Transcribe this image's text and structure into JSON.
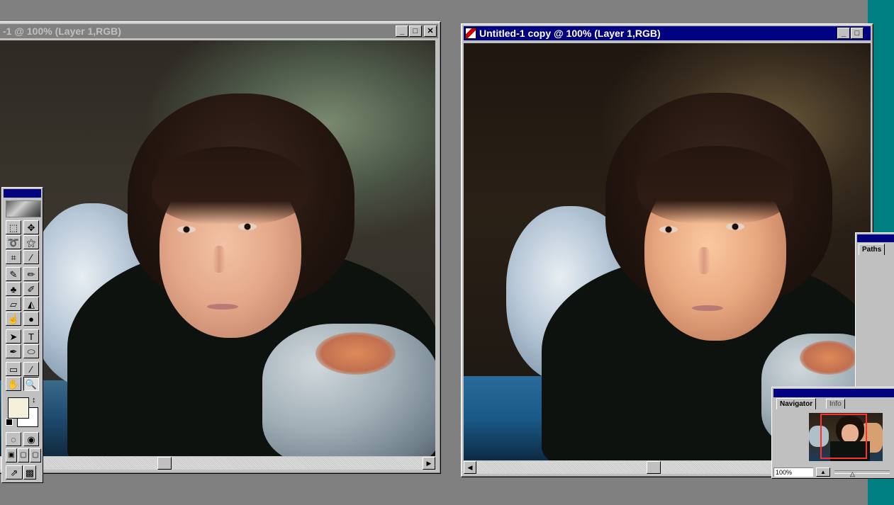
{
  "windows": {
    "original": {
      "title": "-1 @ 100% (Layer 1,RGB)"
    },
    "copy": {
      "title": "Untitled-1 copy @ 100% (Layer 1,RGB)"
    }
  },
  "titlebar_buttons": {
    "minimize": "_",
    "maximize": "□",
    "close": "✕"
  },
  "toolbox": {
    "tools": [
      {
        "name": "marquee-tool-icon",
        "glyph": "⬚"
      },
      {
        "name": "move-tool-icon",
        "glyph": "✥"
      },
      {
        "name": "lasso-tool-icon",
        "glyph": "➰"
      },
      {
        "name": "magic-wand-tool-icon",
        "glyph": "⚝"
      },
      {
        "name": "crop-tool-icon",
        "glyph": "⌗"
      },
      {
        "name": "eyedropper-tool-icon",
        "glyph": "⁄"
      },
      {
        "name": "airbrush-tool-icon",
        "glyph": "✎"
      },
      {
        "name": "pencil-tool-icon",
        "glyph": "✏"
      },
      {
        "name": "rubber-stamp-tool-icon",
        "glyph": "♣"
      },
      {
        "name": "history-brush-tool-icon",
        "glyph": "✐"
      },
      {
        "name": "eraser-tool-icon",
        "glyph": "▱"
      },
      {
        "name": "paint-bucket-tool-icon",
        "glyph": "◭"
      },
      {
        "name": "smudge-tool-icon",
        "glyph": "☝"
      },
      {
        "name": "dodge-tool-icon",
        "glyph": "●"
      },
      {
        "name": "path-select-tool-icon",
        "glyph": "➤"
      },
      {
        "name": "type-tool-icon",
        "glyph": "T"
      },
      {
        "name": "pen-tool-icon",
        "glyph": "✒"
      },
      {
        "name": "ellipse-tool-icon",
        "glyph": "⬭"
      },
      {
        "name": "notes-tool-icon",
        "glyph": "▭"
      },
      {
        "name": "color-sampler-tool-icon",
        "glyph": "⁄"
      },
      {
        "name": "hand-tool-icon",
        "glyph": "✋"
      },
      {
        "name": "zoom-tool-icon",
        "glyph": "🔍"
      },
      {
        "name": "standard-mode-icon",
        "glyph": "◌"
      },
      {
        "name": "quick-mask-mode-icon",
        "glyph": "◉"
      },
      {
        "name": "screen-mode-standard-icon",
        "glyph": "▣"
      },
      {
        "name": "screen-mode-menu-icon",
        "glyph": "▢"
      },
      {
        "name": "screen-mode-full-icon",
        "glyph": "▢"
      },
      {
        "name": "jump-to-imageready-icon",
        "glyph": "⇗"
      },
      {
        "name": "jump-alt-icon",
        "glyph": "▩"
      }
    ],
    "swap_glyph": "↕"
  },
  "paths_panel": {
    "tab": "Paths"
  },
  "navigator": {
    "tabs": [
      "Navigator",
      "Info"
    ],
    "zoom": "100%"
  }
}
